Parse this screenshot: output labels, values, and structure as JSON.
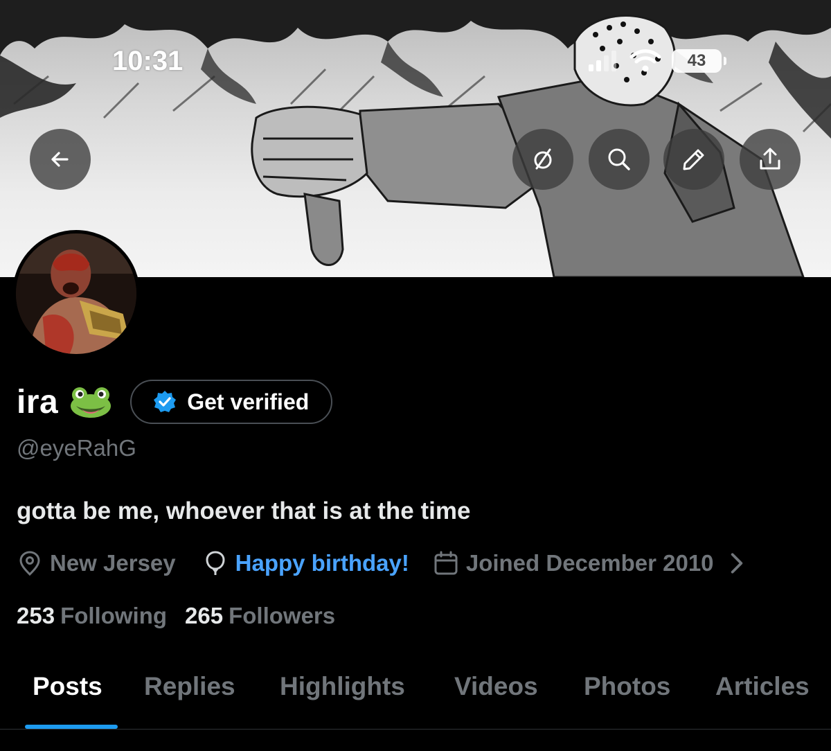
{
  "status_bar": {
    "time": "10:31",
    "battery": "43"
  },
  "header": {
    "back_icon": "arrow-left-icon",
    "actions": [
      "grok-icon",
      "search-icon",
      "edit-pencil-icon",
      "share-icon"
    ]
  },
  "profile": {
    "name": "ira",
    "name_emoji": "frog-face",
    "verify_label": "Get verified",
    "handle": "@eyeRahG",
    "bio": "gotta be me, whoever that is at the time",
    "location": "New Jersey",
    "birthday": "Happy birthday!",
    "joined": "Joined December 2010",
    "following_count": "253",
    "following_label": "Following",
    "followers_count": "265",
    "followers_label": "Followers"
  },
  "tabs": [
    "Posts",
    "Replies",
    "Highlights",
    "Videos",
    "Photos",
    "Articles"
  ],
  "active_tab": "Posts",
  "colors": {
    "accent": "#1d9bf0",
    "muted": "#71767b",
    "background": "#000000"
  }
}
